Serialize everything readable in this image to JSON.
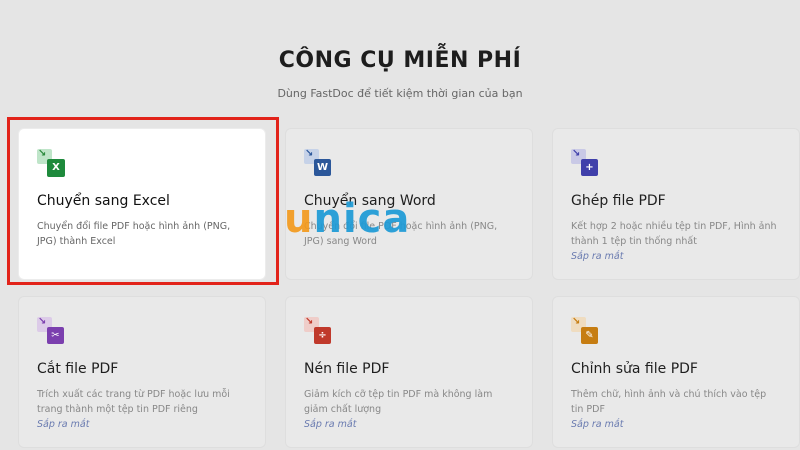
{
  "header": {
    "title": "CÔNG CỤ MIỄN PHÍ",
    "subtitle": "Dùng FastDoc để tiết kiệm thời gian của bạn"
  },
  "watermark": {
    "first": "u",
    "rest": "nica"
  },
  "tools": [
    {
      "title": "Chuyển sang Excel",
      "desc": "Chuyển đổi file PDF hoặc hình ảnh (PNG, JPG) thành Excel",
      "badge": "",
      "icon": "excel-icon",
      "glyph": "X",
      "color": "#1e8a3c",
      "back": "#bfe5c9",
      "arrow": "#2a8a3c",
      "arrow_glyph": "↘"
    },
    {
      "title": "Chuyển sang Word",
      "desc": "Chuyển đổi file PDF hoặc hình ảnh (PNG, JPG) sang Word",
      "badge": "",
      "icon": "word-icon",
      "glyph": "W",
      "color": "#2b579a",
      "back": "#c6d2e8",
      "arrow": "#2b579a",
      "arrow_glyph": "↘"
    },
    {
      "title": "Ghép file PDF",
      "desc": "Kết hợp 2 hoặc nhiều tệp tin PDF, Hình ảnh thành 1 tệp tin thống nhất",
      "badge": "Sắp ra mắt",
      "icon": "merge-pdf-icon",
      "glyph": "+",
      "color": "#3f3faa",
      "back": "#c9c9e6",
      "arrow": "#3f3faa",
      "arrow_glyph": "↘"
    },
    {
      "title": "Cắt file PDF",
      "desc": "Trích xuất các trang từ PDF hoặc lưu mỗi trang thành một tệp tin PDF riêng",
      "badge": "Sắp ra mắt",
      "icon": "split-pdf-icon",
      "glyph": "✂",
      "color": "#7b3fae",
      "back": "#dccbe8",
      "arrow": "#7b3fae",
      "arrow_glyph": "↘"
    },
    {
      "title": "Nén file PDF",
      "desc": "Giảm kích cỡ tệp tin PDF mà không làm giảm chất lượng",
      "badge": "Sắp ra mắt",
      "icon": "compress-pdf-icon",
      "glyph": "÷",
      "color": "#c0392b",
      "back": "#efcdc9",
      "arrow": "#c0392b",
      "arrow_glyph": "↘"
    },
    {
      "title": "Chỉnh sửa file PDF",
      "desc": "Thêm chữ, hình ảnh và chú thích vào tệp tin PDF",
      "badge": "Sắp ra mắt",
      "icon": "edit-pdf-icon",
      "glyph": "✎",
      "color": "#c67d12",
      "back": "#efdcc0",
      "arrow": "#c67d12",
      "arrow_glyph": "↘"
    }
  ]
}
